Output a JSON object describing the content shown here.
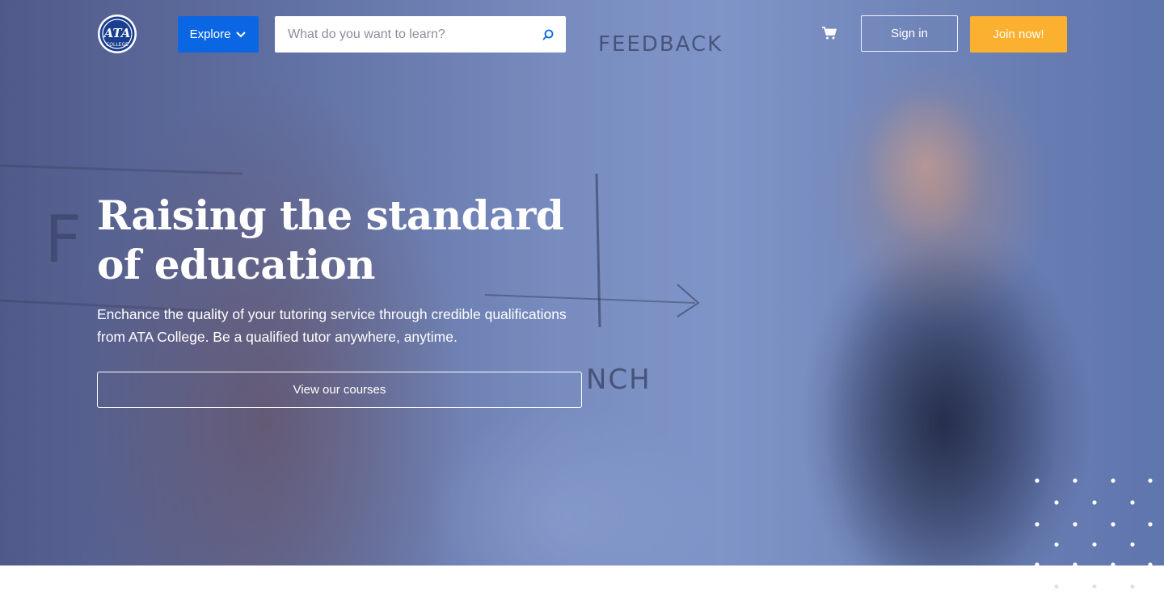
{
  "brand": {
    "logo_top": "ATA",
    "logo_bottom": "COLLEGE",
    "logo_ring_color": "#1b3f8f"
  },
  "nav": {
    "explore_label": "Explore",
    "search_placeholder": "What do you want to learn?",
    "search_value": "",
    "cart_icon": "shopping-cart-icon",
    "signin_label": "Sign in",
    "join_label": "Join now!"
  },
  "hero": {
    "title": "Raising the standard of education",
    "subtitle": "Enchance the quality of your tutoring service through credible qualifications from ATA College. Be a qualified tutor anywhere, anytime.",
    "cta_label": "View our courses",
    "background_scene": "whiteboard-classroom-photo"
  },
  "colors": {
    "primary": "#0b66e4",
    "accent": "#fbb030",
    "overlay": "#2c4a9a",
    "text_on_hero": "#ffffff"
  }
}
